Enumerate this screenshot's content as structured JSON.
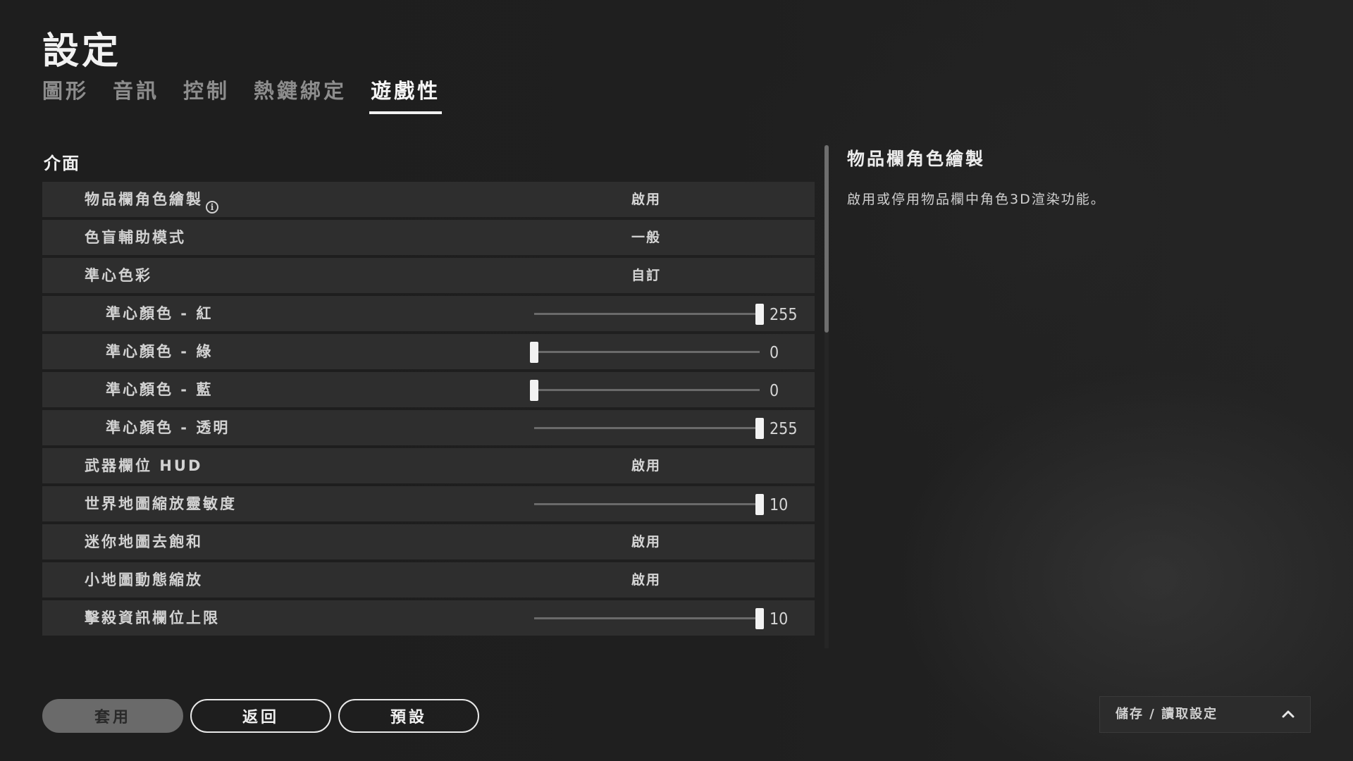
{
  "page": {
    "title": "設定"
  },
  "tabs": [
    {
      "label": "圖形",
      "active": false
    },
    {
      "label": "音訊",
      "active": false
    },
    {
      "label": "控制",
      "active": false
    },
    {
      "label": "熱鍵綁定",
      "active": false
    },
    {
      "label": "遊戲性",
      "active": true
    }
  ],
  "section": {
    "title": "介面"
  },
  "settings": [
    {
      "label": "物品欄角色繪製",
      "type": "option",
      "value": "啟用",
      "info": true
    },
    {
      "label": "色盲輔助模式",
      "type": "option",
      "value": "一般"
    },
    {
      "label": "準心色彩",
      "type": "option",
      "value": "自訂"
    },
    {
      "label": "準心顏色 - 紅",
      "type": "slider",
      "value": "255",
      "fraction": 1.0,
      "sub": true
    },
    {
      "label": "準心顏色 - 綠",
      "type": "slider",
      "value": "0",
      "fraction": 0.0,
      "sub": true
    },
    {
      "label": "準心顏色 - 藍",
      "type": "slider",
      "value": "0",
      "fraction": 0.0,
      "sub": true
    },
    {
      "label": "準心顏色 - 透明",
      "type": "slider",
      "value": "255",
      "fraction": 1.0,
      "sub": true
    },
    {
      "label": "武器欄位 HUD",
      "type": "option",
      "value": "啟用"
    },
    {
      "label": "世界地圖縮放靈敏度",
      "type": "slider",
      "value": "10",
      "fraction": 1.0
    },
    {
      "label": "迷你地圖去飽和",
      "type": "option",
      "value": "啟用"
    },
    {
      "label": "小地圖動態縮放",
      "type": "option",
      "value": "啟用"
    },
    {
      "label": "擊殺資訊欄位上限",
      "type": "slider",
      "value": "10",
      "fraction": 1.0
    }
  ],
  "description": {
    "title": "物品欄角色繪製",
    "text": "啟用或停用物品欄中角色3D渲染功能。"
  },
  "buttons": {
    "apply": "套用",
    "back": "返回",
    "default": "預設"
  },
  "saveload": {
    "label": "儲存 / 讀取設定"
  },
  "icons": {
    "info": "info-icon",
    "chevron": "chevron-up-icon"
  }
}
